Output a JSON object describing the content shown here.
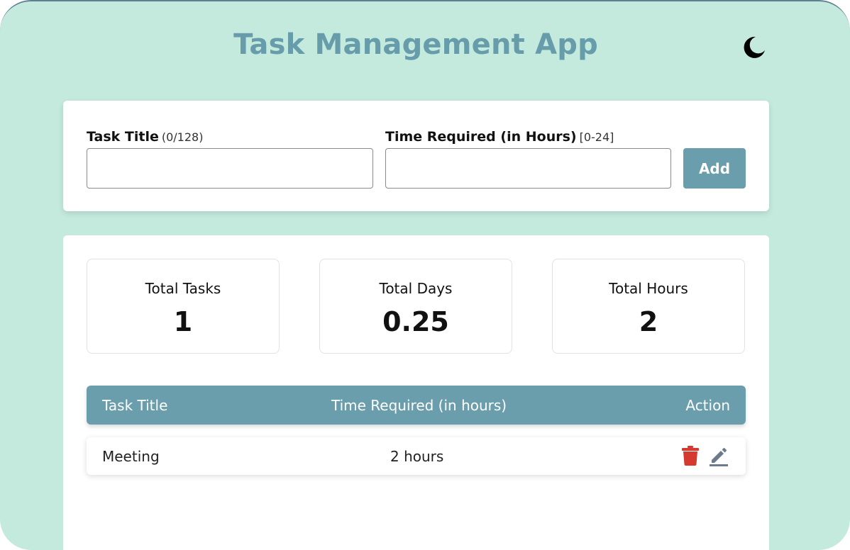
{
  "header": {
    "title": "Task Management App",
    "theme_icon": "moon-icon"
  },
  "form": {
    "task_title": {
      "label": "Task Title",
      "hint": "(0/128)",
      "value": "",
      "placeholder": ""
    },
    "time_required": {
      "label": "Time Required (in Hours)",
      "hint": "[0-24]",
      "value": "",
      "placeholder": ""
    },
    "add_label": "Add"
  },
  "stats": {
    "total_tasks": {
      "label": "Total Tasks",
      "value": "1"
    },
    "total_days": {
      "label": "Total Days",
      "value": "0.25"
    },
    "total_hours": {
      "label": "Total Hours",
      "value": "2"
    }
  },
  "table": {
    "columns": [
      "Task Title",
      "Time Required (in hours)",
      "Action"
    ],
    "rows": [
      {
        "title": "Meeting",
        "time": "2 hours",
        "actions": [
          "trash-icon",
          "edit-pencil-icon"
        ]
      }
    ]
  },
  "colors": {
    "background": "#c4eade",
    "accent": "#6a9eac",
    "title": "#679cab",
    "delete": "#d43a2f",
    "edit": "#6d7a8c"
  }
}
